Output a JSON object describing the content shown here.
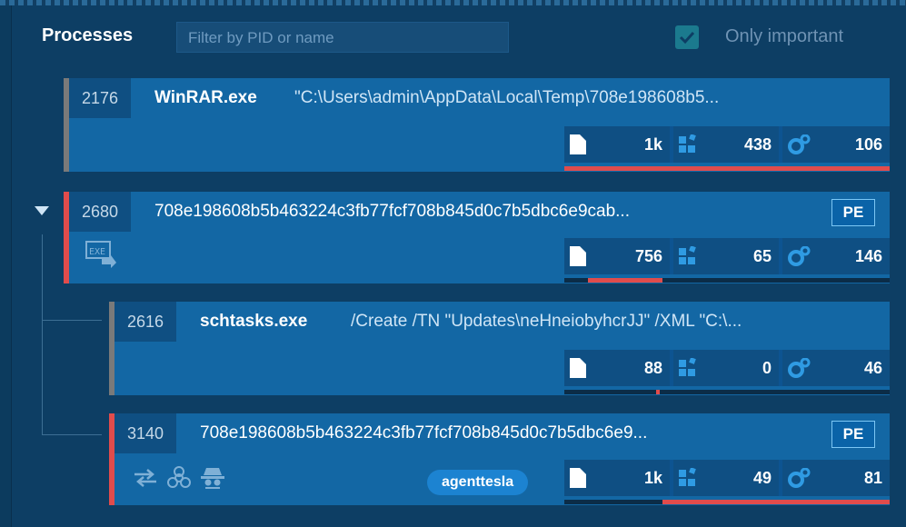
{
  "header": {
    "title": "Processes",
    "filter_placeholder": "Filter by PID or name",
    "only_important_label": "Only important",
    "only_important_checked": true
  },
  "processes": [
    {
      "pid": "2176",
      "name": "WinRAR.exe",
      "command": "\"C:\\Users\\admin\\AppData\\Local\\Temp\\708e198608b5...",
      "stats": {
        "files": "1k",
        "modules": "438",
        "threads": "106"
      },
      "status_color": "#7a7a7a"
    },
    {
      "pid": "2680",
      "title": "708e198608b5b463224c3fb77fcf708b845d0c7b5dbc6e9cab...",
      "badge": "PE",
      "stats": {
        "files": "756",
        "modules": "65",
        "threads": "146"
      },
      "status_color": "#e04c4c"
    },
    {
      "pid": "2616",
      "name": "schtasks.exe",
      "command": "/Create /TN \"Updates\\neHneiobyhcrJJ\" /XML \"C:\\...",
      "stats": {
        "files": "88",
        "modules": "0",
        "threads": "46"
      },
      "status_color": "#7a7a7a"
    },
    {
      "pid": "3140",
      "title": "708e198608b5b463224c3fb77fcf708b845d0c7b5dbc6e9...",
      "badge": "PE",
      "tag": "agenttesla",
      "stats": {
        "files": "1k",
        "modules": "49",
        "threads": "81"
      },
      "status_color": "#e04c4c"
    }
  ],
  "colors": {
    "background": "#0d3e64",
    "card": "#1367a4",
    "danger": "#e04c4c",
    "accent_tag": "#1c83d1"
  },
  "icons": [
    "checkbox-checked-icon",
    "file-icon",
    "modules-icon",
    "gears-icon",
    "collapse-arrow-icon",
    "exe-icon",
    "network-icon",
    "biohazard-icon",
    "spy-icon"
  ]
}
